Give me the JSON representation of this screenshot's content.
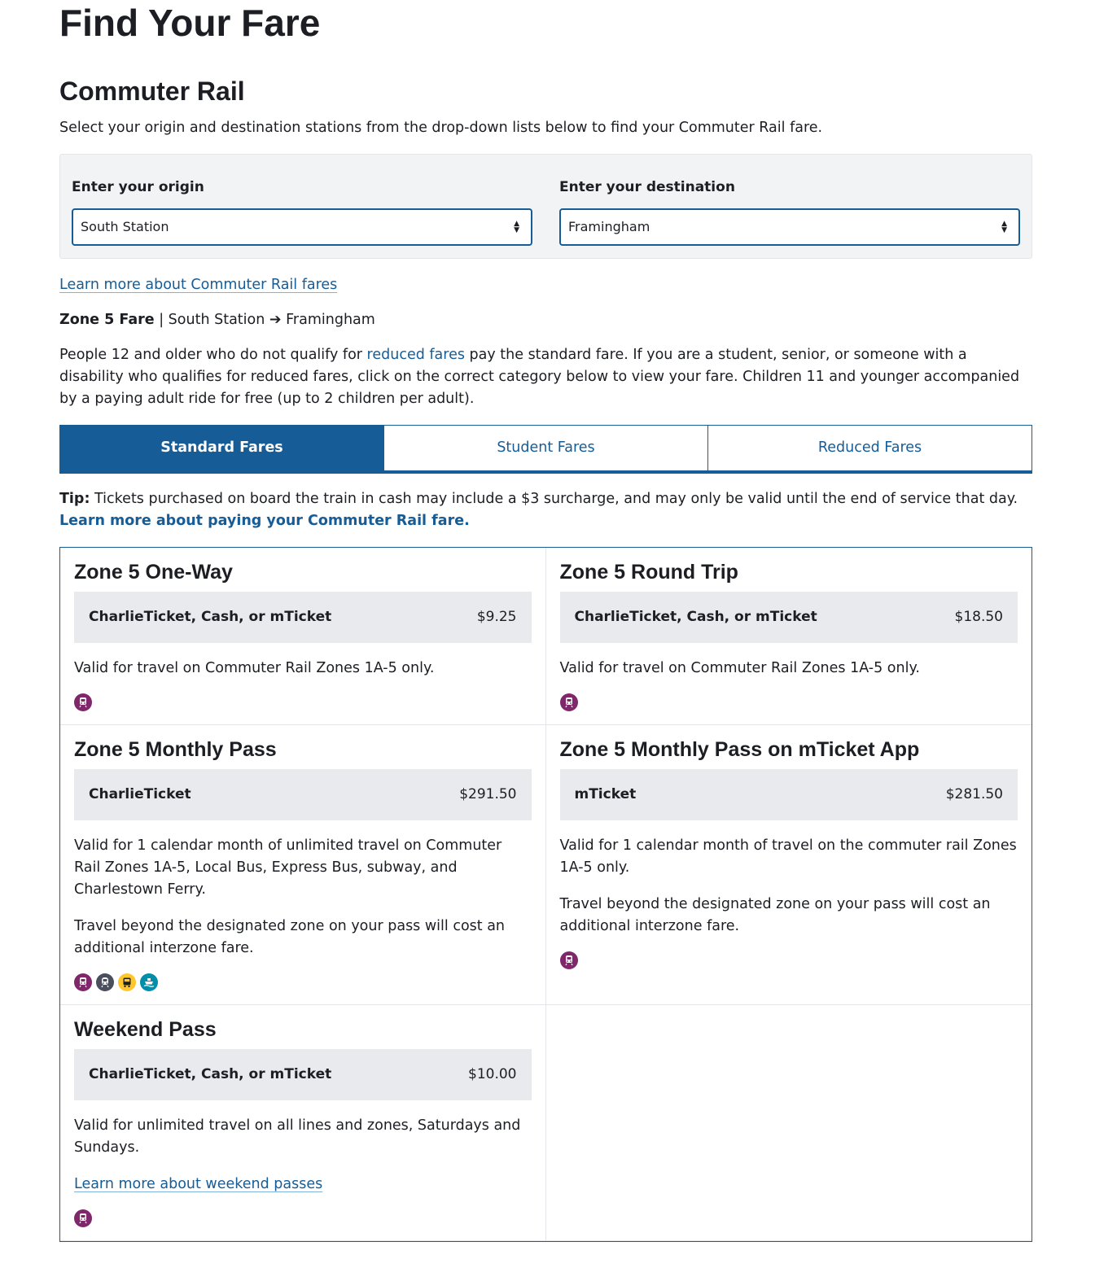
{
  "page_title": "Find Your Fare",
  "section_title": "Commuter Rail",
  "intro": "Select your origin and destination stations from the drop-down lists below to find your Commuter Rail fare.",
  "origin": {
    "label": "Enter your origin",
    "value": "South Station"
  },
  "destination": {
    "label": "Enter your destination",
    "value": "Framingham"
  },
  "learn_more_link": "Learn more about Commuter Rail fares",
  "zone_summary": {
    "zone": "Zone 5 Fare",
    "separator": " | ",
    "from": "South Station",
    "arrow": "➔",
    "to": "Framingham"
  },
  "explain": {
    "before": "People 12 and older who do not qualify for ",
    "link": "reduced fares",
    "after": " pay the standard fare. If you are a student, senior, or someone with a disability who qualifies for reduced fares, click on the correct category below to view your fare. Children 11 and younger accompanied by a paying adult ride for free (up to 2 children per adult)."
  },
  "tabs": [
    {
      "label": "Standard Fares",
      "active": true
    },
    {
      "label": "Student Fares",
      "active": false
    },
    {
      "label": "Reduced Fares",
      "active": false
    }
  ],
  "tip": {
    "label": "Tip:",
    "text": " Tickets purchased on board the train in cash may include a $3 surcharge, and may only be valid until the end of service that day. ",
    "link": "Learn more about paying your Commuter Rail fare."
  },
  "cards": [
    {
      "title": "Zone 5 One-Way",
      "media": "CharlieTicket, Cash, or mTicket",
      "price": "$9.25",
      "desc": [
        "Valid for travel on Commuter Rail Zones 1A-5 only."
      ],
      "icons": [
        "commuter-rail-icon"
      ]
    },
    {
      "title": "Zone 5 Round Trip",
      "media": "CharlieTicket, Cash, or mTicket",
      "price": "$18.50",
      "desc": [
        "Valid for travel on Commuter Rail Zones 1A-5 only."
      ],
      "icons": [
        "commuter-rail-icon"
      ]
    },
    {
      "title": "Zone 5 Monthly Pass",
      "media": "CharlieTicket",
      "price": "$291.50",
      "desc": [
        "Valid for 1 calendar month of unlimited travel on Commuter Rail Zones 1A-5, Local Bus, Express Bus, subway, and Charlestown Ferry.",
        "Travel beyond the designated zone on your pass will cost an additional interzone fare."
      ],
      "icons": [
        "commuter-rail-icon",
        "subway-icon",
        "bus-icon",
        "ferry-icon"
      ]
    },
    {
      "title": "Zone 5 Monthly Pass on mTicket App",
      "media": "mTicket",
      "price": "$281.50",
      "desc": [
        "Valid for 1 calendar month of travel on the commuter rail Zones 1A-5 only.",
        "Travel beyond the designated zone on your pass will cost an additional interzone fare."
      ],
      "icons": [
        "commuter-rail-icon"
      ]
    },
    {
      "title": "Weekend Pass",
      "media": "CharlieTicket, Cash, or mTicket",
      "price": "$10.00",
      "desc": [
        "Valid for unlimited travel on all lines and zones, Saturdays and Sundays."
      ],
      "link": "Learn more about weekend passes",
      "icons": [
        "commuter-rail-icon"
      ]
    }
  ],
  "colors": {
    "brand": "#165c96",
    "commuter_rail": "#80276c",
    "subway": "#494f5c",
    "bus": "#ffc72c",
    "ferry": "#008eaa"
  }
}
